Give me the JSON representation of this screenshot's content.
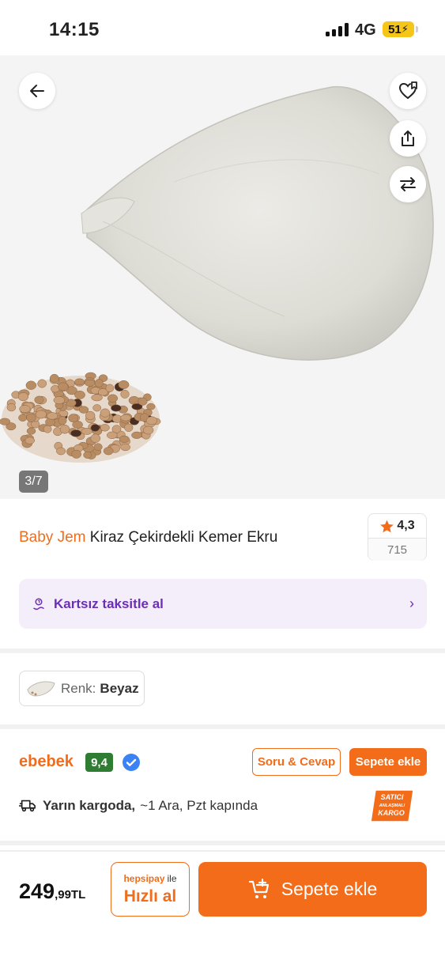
{
  "status_bar": {
    "time": "14:15",
    "network": "4G",
    "battery": "51"
  },
  "gallery": {
    "counter": "3/7",
    "icons": [
      "back-arrow-icon",
      "favorite-list-icon",
      "share-icon",
      "compare-icon"
    ]
  },
  "product": {
    "brand": "Baby Jem",
    "title": "Kiraz Çekirdekli Kemer Ekru",
    "rating": "4,3",
    "review_count": "715"
  },
  "installment": {
    "label": "Kartsız taksitle al"
  },
  "variant": {
    "key": "Renk:",
    "value": "Beyaz"
  },
  "seller": {
    "name": "ebebek",
    "score": "9,4",
    "qa_button": "Soru & Cevap",
    "add_button": "Sepete ekle",
    "delivery_strong": "Yarın kargoda,",
    "delivery_rest": "~1 Ara, Pzt kapında",
    "badge": [
      "SATICI",
      "ANLAŞMALI",
      "KARGO"
    ]
  },
  "bottom": {
    "price_int": "249",
    "price_dec": ",99TL",
    "hepsipay_brand": "hepsipay",
    "hepsipay_ile": "ile",
    "quick_buy": "Hızlı al",
    "add_to_cart": "Sepete ekle"
  },
  "colors": {
    "accent": "#f26c1a",
    "installment_purple": "#6b2fb3",
    "score_green": "#2e7d32"
  }
}
